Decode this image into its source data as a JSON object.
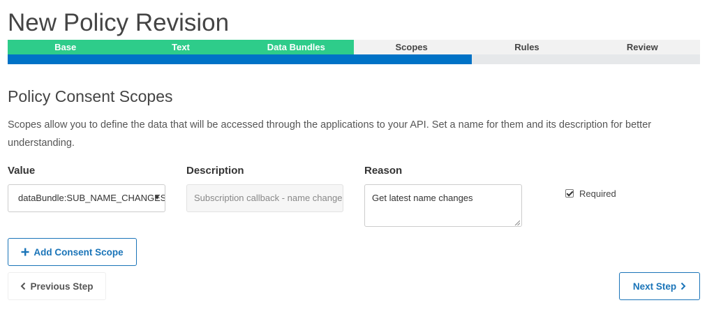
{
  "page": {
    "title": "New Policy Revision"
  },
  "steps": [
    {
      "label": "Base",
      "state": "done"
    },
    {
      "label": "Text",
      "state": "done"
    },
    {
      "label": "Data Bundles",
      "state": "done"
    },
    {
      "label": "Scopes",
      "state": "current"
    },
    {
      "label": "Rules",
      "state": "todo"
    },
    {
      "label": "Review",
      "state": "todo"
    }
  ],
  "progress": {
    "percent": 67
  },
  "section": {
    "title": "Policy Consent Scopes",
    "description": "Scopes allow you to define the data that will be accessed through the applications to your API. Set a name for them and its description for better understanding."
  },
  "form": {
    "value_label": "Value",
    "description_label": "Description",
    "reason_label": "Reason",
    "value_selected": "dataBundle:SUB_NAME_CHANGES",
    "description_value": "Subscription callback - name changes",
    "reason_value": "Get latest name changes",
    "required_label": "Required",
    "required_checked": true
  },
  "buttons": {
    "add_scope": "Add Consent Scope",
    "previous": "Previous Step",
    "next": "Next Step"
  },
  "colors": {
    "step_done": "#2ecc8a",
    "progress_fill": "#0072c6",
    "primary": "#1a74b8"
  },
  "icons": {
    "add": "plus-icon",
    "previous": "chevron-left-icon",
    "next": "chevron-right-icon",
    "select": "caret-down-icon"
  }
}
